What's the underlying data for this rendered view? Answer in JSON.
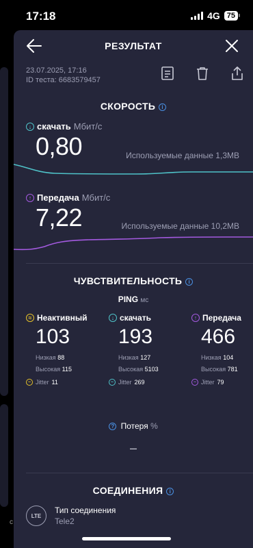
{
  "status": {
    "time": "17:18",
    "network": "4G",
    "battery": "75"
  },
  "header": {
    "title": "РЕЗУЛЬТАТ"
  },
  "meta": {
    "datetime": "23.07.2025, 17:16",
    "test_id": "ID теста: 6683579457"
  },
  "speed": {
    "title": "СКОРОСТЬ",
    "download": {
      "label": "скачать",
      "unit": "Мбит/с",
      "value": "0,80",
      "used": "Используемые данные 1,3MB",
      "color": "#4fc3c9"
    },
    "upload": {
      "label": "Передача",
      "unit": "Мбит/с",
      "value": "7,22",
      "used": "Используемые данные 10,2MB",
      "color": "#a45ae0"
    }
  },
  "sensitivity": {
    "title": "ЧУВСТВИТЕЛЬНОСТЬ",
    "ping_label": "PING",
    "ping_unit": "мс",
    "columns": [
      {
        "label": "Неактивный",
        "value": "103",
        "low_label": "Низкая",
        "low": "88",
        "high_label": "Высокая",
        "high": "115",
        "jitter_label": "Jitter",
        "jitter": "11",
        "color": "#e6c229"
      },
      {
        "label": "скачать",
        "value": "193",
        "low_label": "Низкая",
        "low": "127",
        "high_label": "Высокая",
        "high": "5103",
        "jitter_label": "Jitter",
        "jitter": "269",
        "color": "#4fc3c9"
      },
      {
        "label": "Передача",
        "value": "466",
        "low_label": "Низкая",
        "low": "104",
        "high_label": "Высокая",
        "high": "781",
        "jitter_label": "Jitter",
        "jitter": "79",
        "color": "#a45ae0"
      }
    ],
    "loss_label": "Потеря",
    "loss_unit": "%",
    "loss_value": "–"
  },
  "connections": {
    "title": "СОЕДИНЕНИЯ",
    "badge": "LTE",
    "type_label": "Тип соединения",
    "type_value": "Tele2"
  },
  "background": {
    "fragment": "с"
  }
}
